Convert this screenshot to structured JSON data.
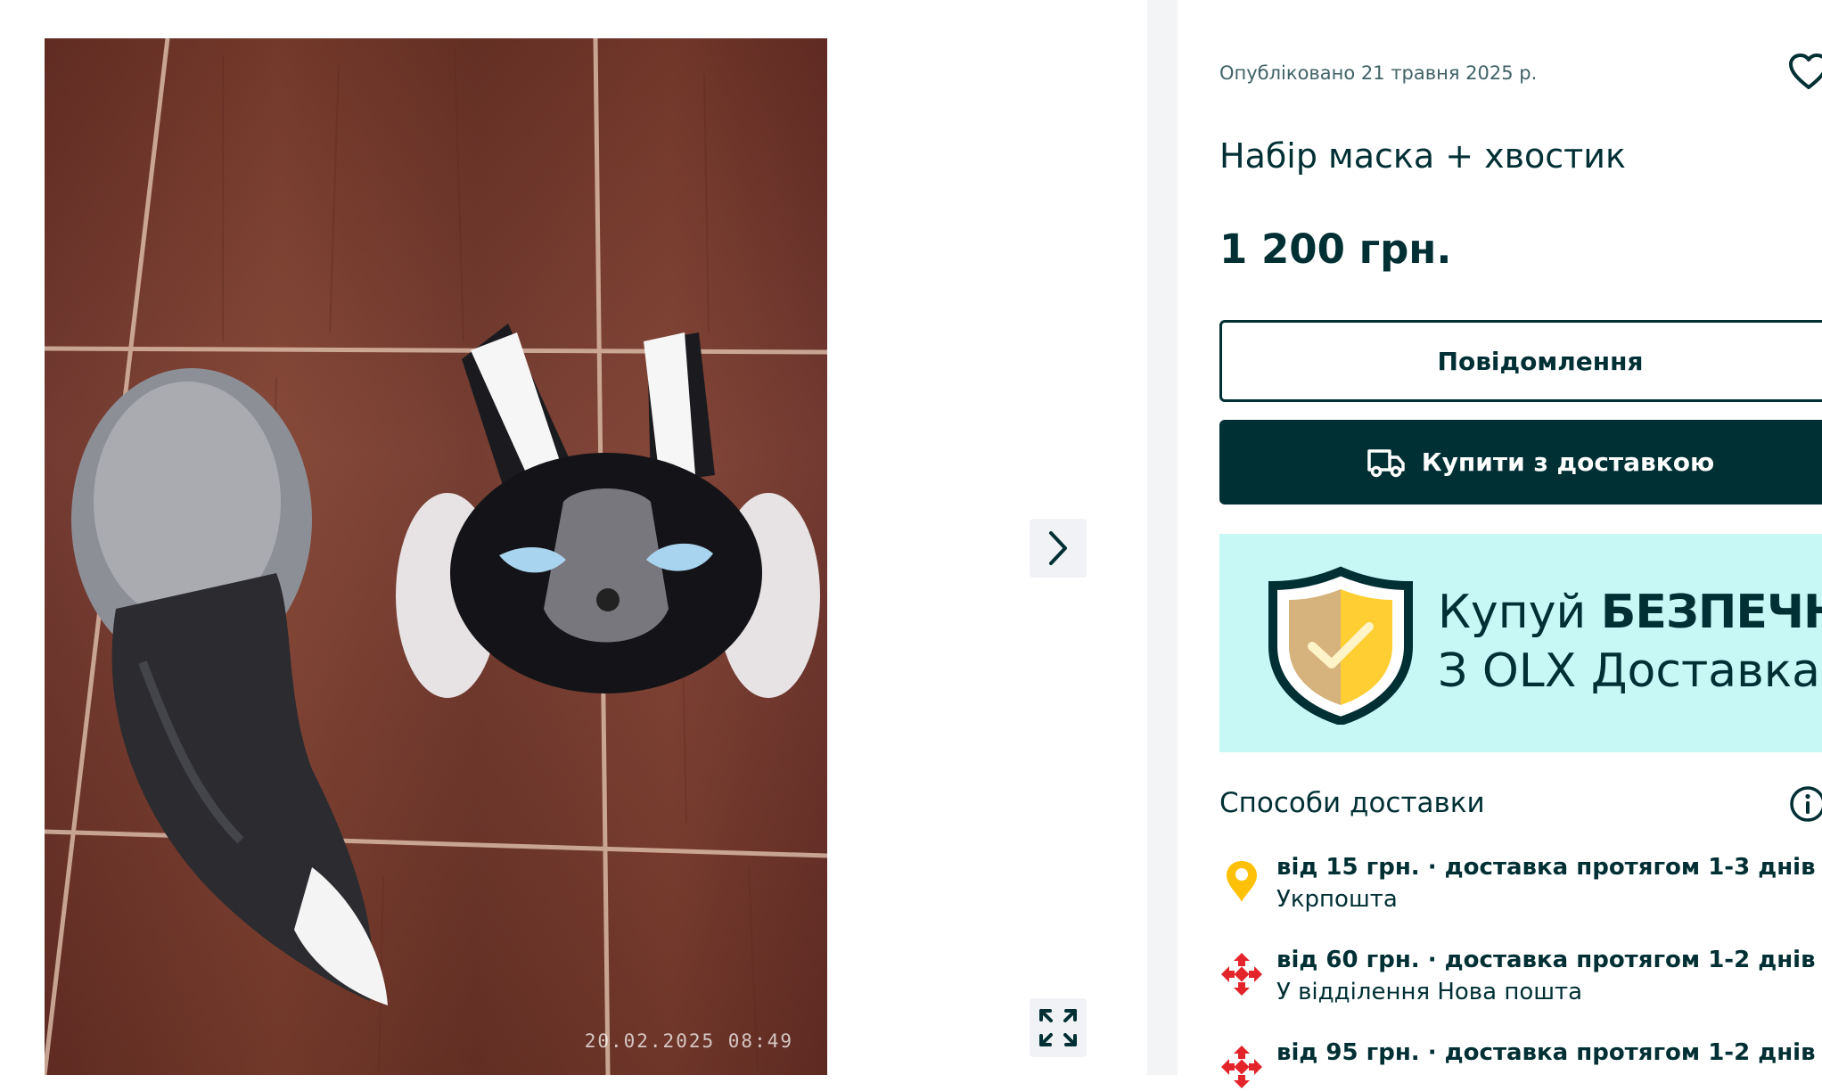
{
  "photo": {
    "timestamp": "20.02.2025   08:49"
  },
  "gallery": {
    "next_icon": "chevron-right-icon",
    "expand_icon": "expand-arrows-icon"
  },
  "ad": {
    "posted": "Опубліковано 21 травня 2025 р.",
    "title": "Набір маска + хвостик",
    "price": "1 200 грн."
  },
  "actions": {
    "message_label": "Повідомлення",
    "buy_label": "Купити з доставкою"
  },
  "banner": {
    "word1": "Купуй",
    "word2": "БЕЗПЕЧНО",
    "line2": "З OLX Доставка"
  },
  "delivery": {
    "heading": "Способи доставки",
    "options": [
      {
        "line1": "від 15 грн. · доставка протягом 1-3 днів",
        "line2": "Укрпошта",
        "icon": "ukrposhta-icon",
        "color": "#ffc107"
      },
      {
        "line1": "від 60 грн. · доставка протягом 1-2 днів",
        "line2": "У відділення Нова пошта",
        "icon": "nova-poshta-icon",
        "color": "#e3252b"
      },
      {
        "line1": "від 95 грн. · доставка протягом 1-2 днів",
        "line2": "",
        "icon": "nova-poshta-icon",
        "color": "#e3252b"
      }
    ]
  },
  "colors": {
    "brand_dark": "#002f34",
    "banner_bg": "#c8f8f6",
    "muted_text": "#406367"
  }
}
